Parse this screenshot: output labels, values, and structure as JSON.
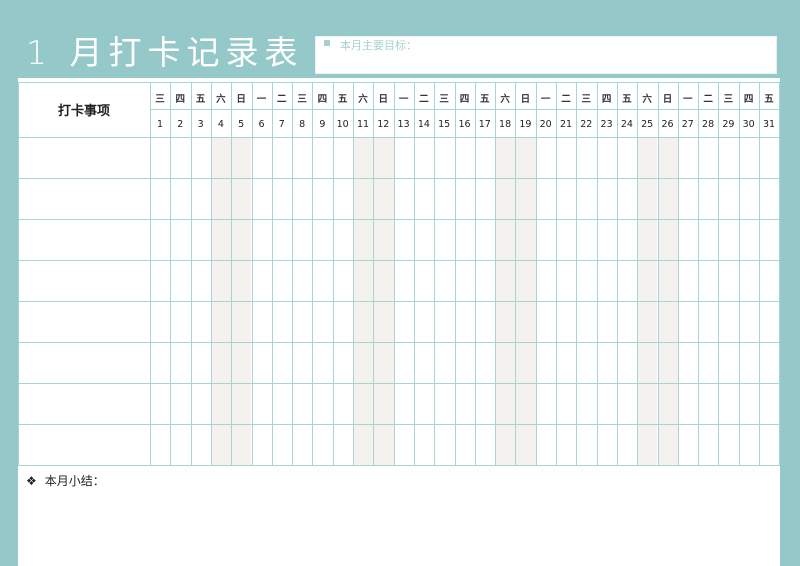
{
  "title": "1 月打卡记录表",
  "goal_label": "本月主要目标：",
  "item_header": "打卡事项",
  "weekdays": [
    "三",
    "四",
    "五",
    "六",
    "日",
    "一",
    "二",
    "三",
    "四",
    "五",
    "六",
    "日",
    "一",
    "二",
    "三",
    "四",
    "五",
    "六",
    "日",
    "一",
    "二",
    "三",
    "四",
    "五",
    "六",
    "日",
    "一",
    "二",
    "三",
    "四",
    "五"
  ],
  "days": [
    "1",
    "2",
    "3",
    "4",
    "5",
    "6",
    "7",
    "8",
    "9",
    "10",
    "11",
    "12",
    "13",
    "14",
    "15",
    "16",
    "17",
    "18",
    "19",
    "20",
    "21",
    "22",
    "23",
    "24",
    "25",
    "26",
    "27",
    "28",
    "29",
    "30",
    "31"
  ],
  "rows": [
    "",
    "",
    "",
    "",
    "",
    "",
    "",
    ""
  ],
  "summary": {
    "icon": "diamond-dots-icon",
    "label": "本月小结："
  },
  "colors": {
    "accent": "#95c8c8",
    "weekend_shade": "#f4f1ef",
    "grid_line": "#a9d4d4"
  }
}
